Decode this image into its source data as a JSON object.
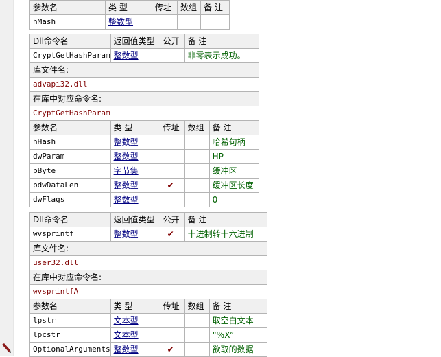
{
  "table0": {
    "headers": [
      "参数名",
      "类 型",
      "传址",
      "数组",
      "备 注"
    ],
    "rows": [
      {
        "name": "hMash",
        "type": "整数型",
        "byref": false,
        "array": false,
        "note": ""
      }
    ]
  },
  "table1": {
    "dll_headers": [
      "Dll命令名",
      "返回值类型",
      "公开",
      "备 注"
    ],
    "dll": {
      "name": "CryptGetHashParam",
      "return_type": "整数型",
      "public": false,
      "note": "非零表示成功。"
    },
    "lib_label": "库文件名:",
    "lib_value": "advapi32.dll",
    "cmd_label": "在库中对应命令名:",
    "cmd_value": "CryptGetHashParam",
    "param_headers": [
      "参数名",
      "类 型",
      "传址",
      "数组",
      "备 注"
    ],
    "params": [
      {
        "name": "hHash",
        "type": "整数型",
        "byref": false,
        "array": false,
        "note": "哈希句柄"
      },
      {
        "name": "dwParam",
        "type": "整数型",
        "byref": false,
        "array": false,
        "note": "HP_"
      },
      {
        "name": "pByte",
        "type": "字节集",
        "byref": false,
        "array": false,
        "note": "缓冲区"
      },
      {
        "name": "pdwDataLen",
        "type": "整数型",
        "byref": true,
        "array": false,
        "note": "缓冲区长度"
      },
      {
        "name": "dwFlags",
        "type": "整数型",
        "byref": false,
        "array": false,
        "note": "0"
      }
    ]
  },
  "table2": {
    "dll_headers": [
      "Dll命令名",
      "返回值类型",
      "公开",
      "备 注"
    ],
    "dll": {
      "name": "wvsprintf",
      "return_type": "整数型",
      "public": true,
      "note": "十进制转十六进制"
    },
    "lib_label": "库文件名:",
    "lib_value": "user32.dll",
    "cmd_label": "在库中对应命令名:",
    "cmd_value": "wvsprintfA",
    "param_headers": [
      "参数名",
      "类 型",
      "传址",
      "数组",
      "备 注"
    ],
    "params": [
      {
        "name": "lpstr",
        "type": "文本型",
        "byref": false,
        "array": false,
        "note": "取空白文本"
      },
      {
        "name": "lpcstr",
        "type": "文本型",
        "byref": false,
        "array": false,
        "note": "“%X”"
      },
      {
        "name": "OptionalArguments",
        "type": "整数型",
        "byref": true,
        "array": false,
        "note": "欲取的数据"
      }
    ]
  },
  "check_glyph": "✔",
  "colors": {
    "name_red": "#800000",
    "type_blue": "#000080",
    "note_green": "#006000",
    "header_bg": "#f0f0f0",
    "border": "#b4b4b4"
  }
}
